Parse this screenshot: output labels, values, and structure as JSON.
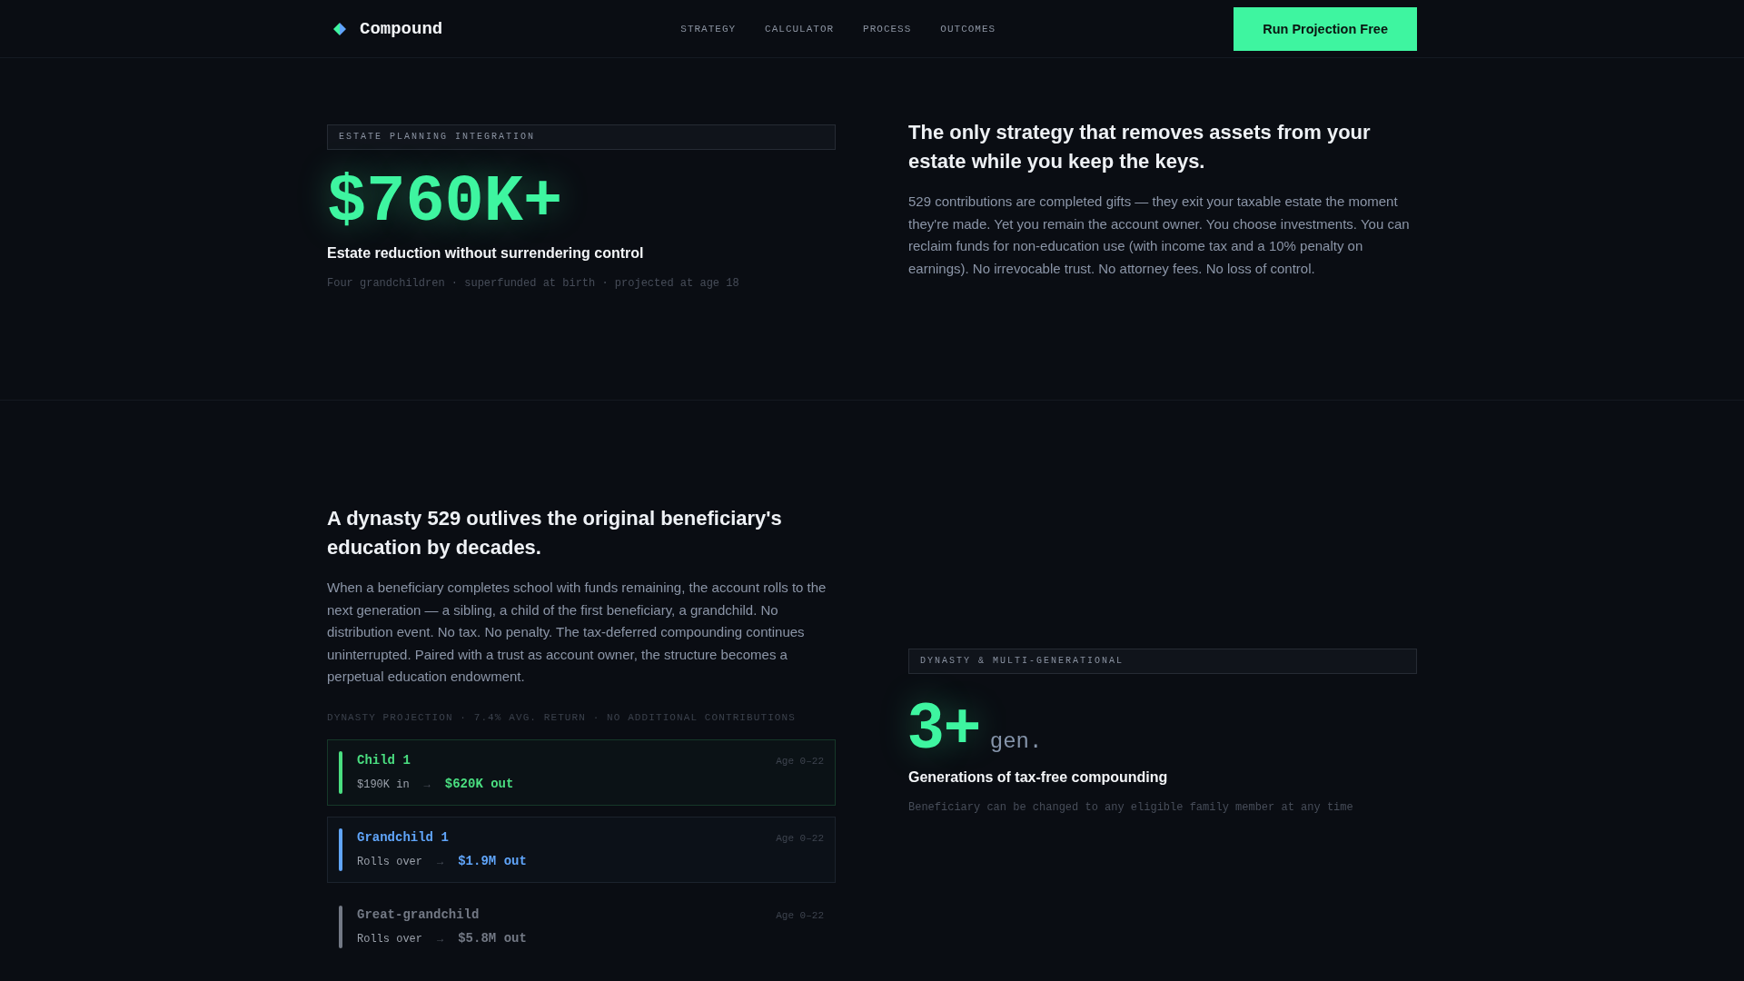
{
  "nav": {
    "brand": "Compound",
    "links": [
      "STRATEGY",
      "CALCULATOR",
      "PROCESS",
      "OUTCOMES"
    ],
    "cta": "Run Projection Free"
  },
  "estate": {
    "tag": "ESTATE PLANNING INTEGRATION",
    "stat": "$760K+",
    "stat_label": "Estate reduction without surrendering control",
    "note": "Four grandchildren · superfunded at birth · projected at age 18",
    "heading": "The only strategy that removes assets from your estate while you keep the keys.",
    "body": "529 contributions are completed gifts — they exit your taxable estate the moment they're made. Yet you remain the account owner. You choose investments. You can reclaim funds for non-education use (with income tax and a 10% penalty on earnings). No irrevocable trust. No attorney fees. No loss of control."
  },
  "dynasty": {
    "heading": "A dynasty 529 outlives the original beneficiary's education by decades.",
    "body": "When a beneficiary completes school with funds remaining, the account rolls to the next generation — a sibling, a child of the first beneficiary, a grandchild. No distribution event. No tax. No penalty. The tax-deferred compounding continues uninterrupted. Paired with a trust as account owner, the structure becomes a perpetual education endowment.",
    "projection_label": "DYNASTY PROJECTION · 7.4% AVG. RETURN · NO ADDITIONAL CONTRIBUTIONS",
    "generations": [
      {
        "kind": "highlighted",
        "color": "#4ade80",
        "name": "Child 1",
        "age": "Age 0–22",
        "flow": "$190K in",
        "arrow": "→",
        "result": "$620K out"
      },
      {
        "kind": "outlined",
        "color": "#60a5fa",
        "name": "Grandchild 1",
        "age": "Age 0–22",
        "flow": "Rolls over",
        "arrow": "→",
        "result": "$1.9M out"
      },
      {
        "kind": "plain",
        "color": "#737985",
        "name": "Great-grandchild",
        "age": "Age 0–22",
        "flow": "Rolls over",
        "arrow": "→",
        "result": "$5.8M out"
      }
    ],
    "tag": "DYNASTY & MULTI-GENERATIONAL",
    "stat": "3+",
    "stat_unit": "gen.",
    "stat_label": "Generations of tax-free compounding",
    "note": "Beneficiary can be changed to any eligible family member at any time"
  }
}
